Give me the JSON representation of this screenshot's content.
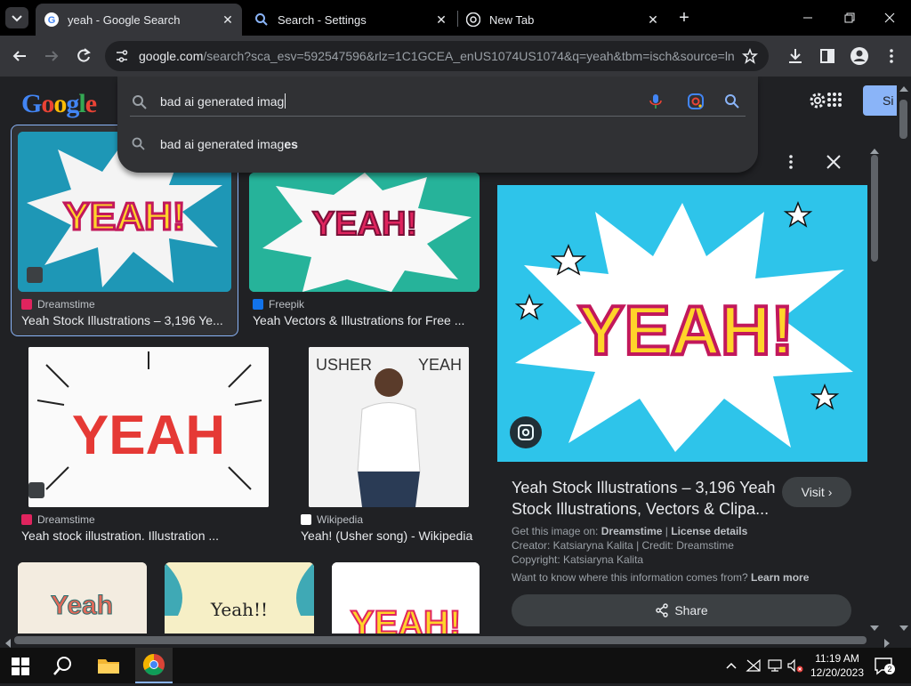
{
  "tabs": [
    {
      "title": "yeah - Google Search",
      "active": true,
      "icon": "google-g-icon"
    },
    {
      "title": "Search - Settings",
      "active": false,
      "icon": "search-icon"
    },
    {
      "title": "New Tab",
      "active": false,
      "icon": "chrome-icon"
    }
  ],
  "toolbar": {
    "url_host": "google.com",
    "url_rest": "/search?sca_esv=592547596&rlz=1C1GCEA_enUS1074US1074&q=yeah&tbm=isch&source=ln..."
  },
  "google": {
    "logo": "Google",
    "search_value": "bad ai generated imag",
    "suggestion_prefix": "bad ai generated imag",
    "suggestion_suffix": "es",
    "sign_in_label": "Si"
  },
  "results": [
    {
      "source": "Dreamstime",
      "title": "Yeah Stock Illustrations – 3,196 Ye...",
      "img_text": "YEAH!"
    },
    {
      "source": "Freepik",
      "title": "Yeah Vectors & Illustrations for Free ...",
      "img_text": "YEAH!"
    },
    {
      "source": "Dreamstime",
      "title": "Yeah stock illustration. Illustration ...",
      "img_text": "YEAH"
    },
    {
      "source": "Wikipedia",
      "title": "Yeah! (Usher song) - Wikipedia",
      "img_text_left": "USHER",
      "img_text_right": "YEAH"
    },
    {
      "img_text": "Yeah"
    },
    {
      "img_text": "Yeah!!"
    },
    {
      "img_text": "YEAH!"
    }
  ],
  "panel": {
    "img_text": "YEAH!",
    "title": "Yeah Stock Illustrations – 3,196 Yeah Stock Illustrations, Vectors & Clipa...",
    "visit_label": "Visit",
    "get_image_label": "Get this image on:",
    "get_image_source": "Dreamstime",
    "separator": "|",
    "license_label": "License details",
    "creator_line": "Creator: Katsiaryna Kalita | Credit: Dreamstime",
    "copyright_line": "Copyright: Katsiaryna Kalita",
    "info_question": "Want to know where this information comes from?",
    "learn_more": "Learn more",
    "share_label": "Share"
  },
  "taskbar": {
    "time": "11:19 AM",
    "date": "12/20/2023",
    "notification_count": "2"
  },
  "colors": {
    "accent_blue": "#8ab4f8",
    "signin_blue": "#8ab4f8",
    "cyan_bg": "#2ec4ea",
    "yeah_yellow": "#ffd42a",
    "yeah_red": "#e0245e"
  }
}
